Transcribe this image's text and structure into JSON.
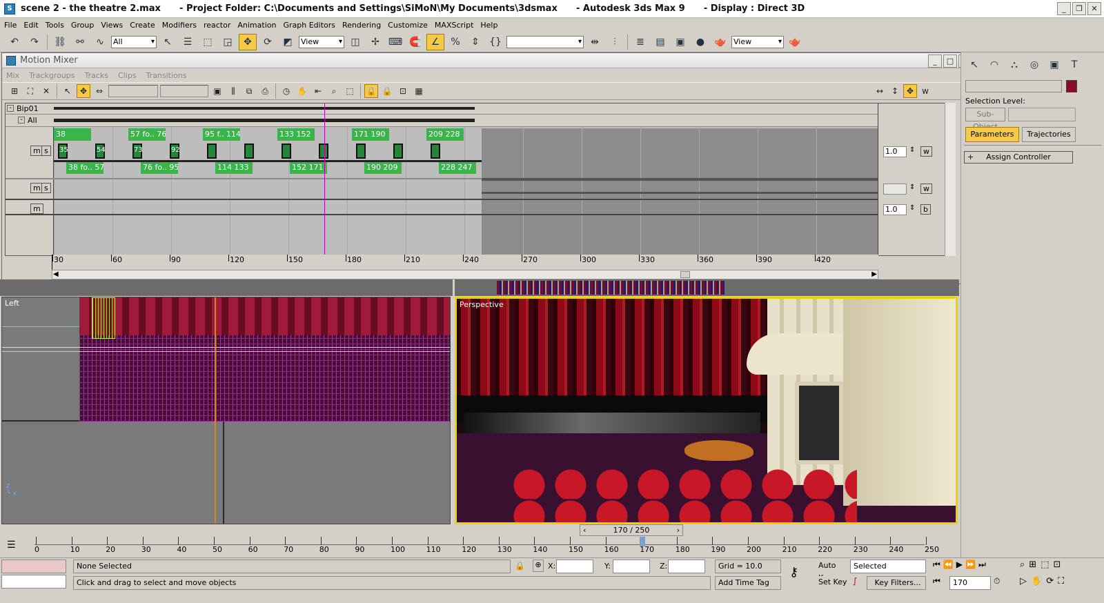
{
  "window": {
    "title": "scene 2 - the theatre 2.max      - Project Folder: C:\\Documents and Settings\\SiMoN\\My Documents\\3dsmax      - Autodesk 3ds Max 9      - Display : Direct 3D"
  },
  "menubar": [
    "File",
    "Edit",
    "Tools",
    "Group",
    "Views",
    "Create",
    "Modifiers",
    "reactor",
    "Animation",
    "Graph Editors",
    "Rendering",
    "Customize",
    "MAXScript",
    "Help"
  ],
  "toolbar": {
    "selection_filter": "All",
    "ref_coord_1": "View",
    "ref_coord_2": "View"
  },
  "mixer": {
    "title": "Motion Mixer",
    "menu": [
      "Mix",
      "Trackgroups",
      "Tracks",
      "Clips",
      "Transitions"
    ],
    "track_bip": "Bip01",
    "track_all": "All",
    "btn_m": "m",
    "btn_s": "s",
    "btn_w": "w",
    "btn_b": "b",
    "weight_1": "1.0",
    "weight_3": "1.0",
    "clips_top": [
      "38",
      "57  fo..  76",
      "95  f..  114",
      "133    152",
      "171    190",
      "209    228"
    ],
    "trans_labels": [
      "35",
      "54",
      "73",
      "92"
    ],
    "clips_bottom": [
      "38  fo..  57",
      "76  fo..  95",
      "114    133",
      "152    171",
      "190    209",
      "228    247"
    ],
    "ruler": [
      "30",
      "60",
      "90",
      "120",
      "150",
      "180",
      "210",
      "240",
      "270",
      "300",
      "330",
      "360",
      "390",
      "420"
    ]
  },
  "viewports": {
    "left_label": "Left",
    "persp_label": "Perspective"
  },
  "time_slider": "170 / 250",
  "timeline_ticks": [
    "0",
    "10",
    "20",
    "30",
    "40",
    "50",
    "60",
    "70",
    "80",
    "90",
    "100",
    "110",
    "120",
    "130",
    "140",
    "150",
    "160",
    "170",
    "180",
    "190",
    "200",
    "210",
    "220",
    "230",
    "240",
    "250"
  ],
  "cmd": {
    "selection_level": "Selection Level:",
    "sub_object": "Sub-Object",
    "parameters": "Parameters",
    "trajectories": "Trajectories",
    "assign_controller": "Assign Controller",
    "color": "#8a0a2a"
  },
  "status": {
    "selection": "None Selected",
    "prompt": "Click and drag to select and move objects",
    "x_label": "X:",
    "y_label": "Y:",
    "z_label": "Z:",
    "grid": "Grid = 10.0",
    "add_time_tag": "Add Time Tag",
    "auto_key": "Auto Key",
    "set_key": "Set Key",
    "key_mode": "Selected",
    "key_filters": "Key Filters...",
    "frame": "170"
  }
}
